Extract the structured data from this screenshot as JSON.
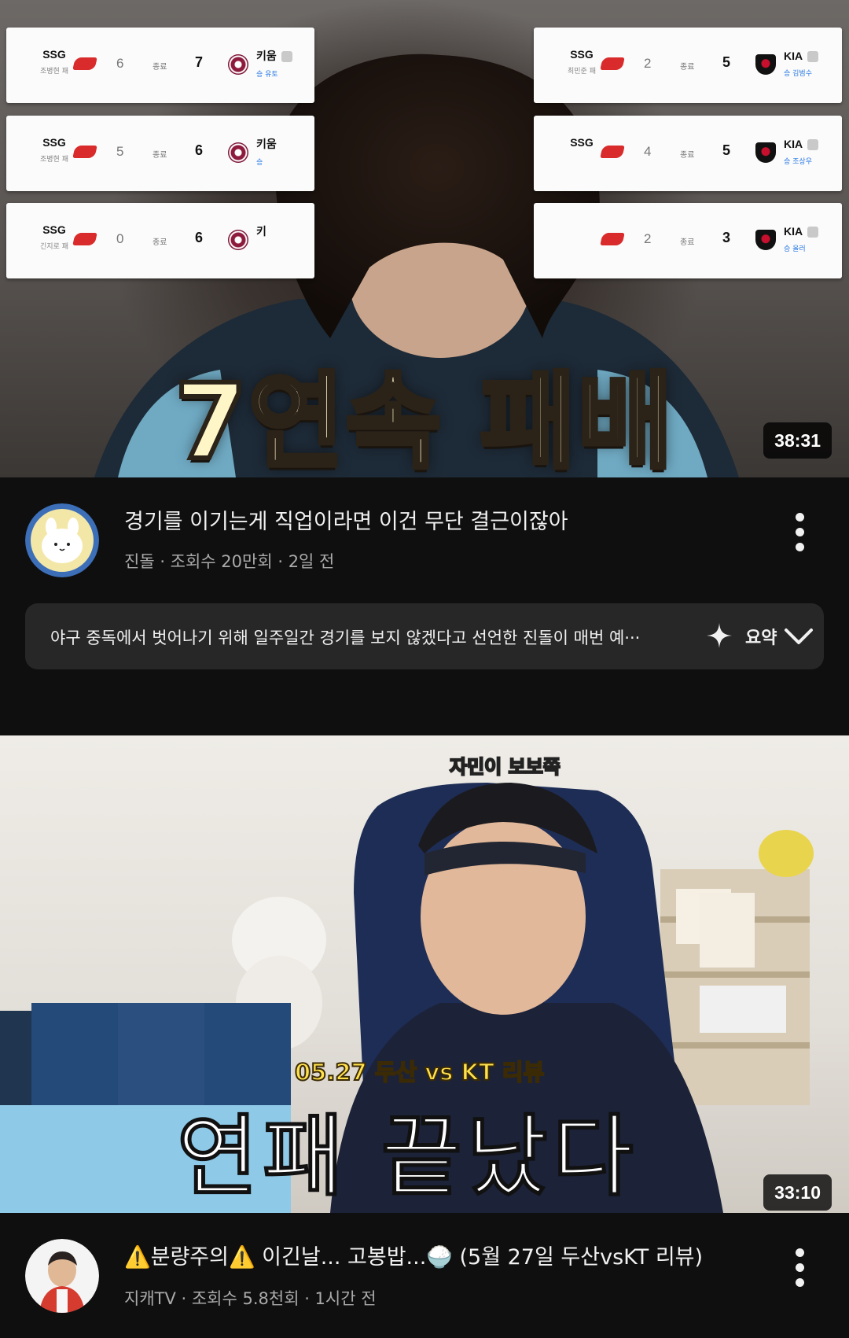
{
  "videos": [
    {
      "thumbnail": {
        "overlay_text": "7연속 패배",
        "duration": "38:31",
        "scoreboards_left": [
          {
            "away": "SSG",
            "away_pitcher": "조병현 패",
            "away_score": "6",
            "status": "종료",
            "home_score": "7",
            "home": "키움",
            "home_pitcher": "승 유토"
          },
          {
            "away": "SSG",
            "away_pitcher": "조병현 패",
            "away_score": "5",
            "status": "종료",
            "home_score": "6",
            "home": "키움",
            "home_pitcher": "승"
          },
          {
            "away": "SSG",
            "away_pitcher": "긴지로 패",
            "away_score": "0",
            "status": "종료",
            "home_score": "6",
            "home": "키",
            "home_pitcher": ""
          }
        ],
        "scoreboards_right": [
          {
            "away": "SSG",
            "away_pitcher": "최민준 패",
            "away_score": "2",
            "status": "종료",
            "home_score": "5",
            "home": "KIA",
            "home_pitcher": "승 김범수"
          },
          {
            "away": "SSG",
            "away_pitcher": "",
            "away_score": "4",
            "status": "종료",
            "home_score": "5",
            "home": "KIA",
            "home_pitcher": "승 조상우"
          },
          {
            "away": "",
            "away_pitcher": "",
            "away_score": "2",
            "status": "종료",
            "home_score": "3",
            "home": "KIA",
            "home_pitcher": "승 올러"
          }
        ]
      },
      "title": "경기를 이기는게 직업이라면 이건 무단 결근이잖아",
      "channel_line": "진돌 · 조회수 20만회 · 2일 전",
      "summary": {
        "text": "야구 중독에서 벗어나기 위해 일주일간 경기를 보지 않겠다고 선언한 진돌이 매번 예···",
        "label": "요약"
      }
    },
    {
      "thumbnail": {
        "top_caption_a": "자민이 ",
        "top_caption_b": "보보쪽",
        "sub_caption": "05.27 두산 vs KT 리뷰",
        "overlay_text": "연패 끝났다",
        "duration": "33:10"
      },
      "title": "⚠️분량주의⚠️ 이긴날... 고봉밥...🍚 (5월 27일 두산vsKT 리뷰)",
      "channel_line": "지캐TV · 조회수 5.8천회 · 1시간 전"
    }
  ],
  "colors": {
    "background": "#0f0f0f",
    "text_primary": "#f1f1f1",
    "text_secondary": "#aaaaaa",
    "summary_bg": "#272727"
  },
  "icons": {
    "more": "vertical-three-dots",
    "summary_spark": "four-point-sparkle",
    "expand": "chevron-down"
  }
}
